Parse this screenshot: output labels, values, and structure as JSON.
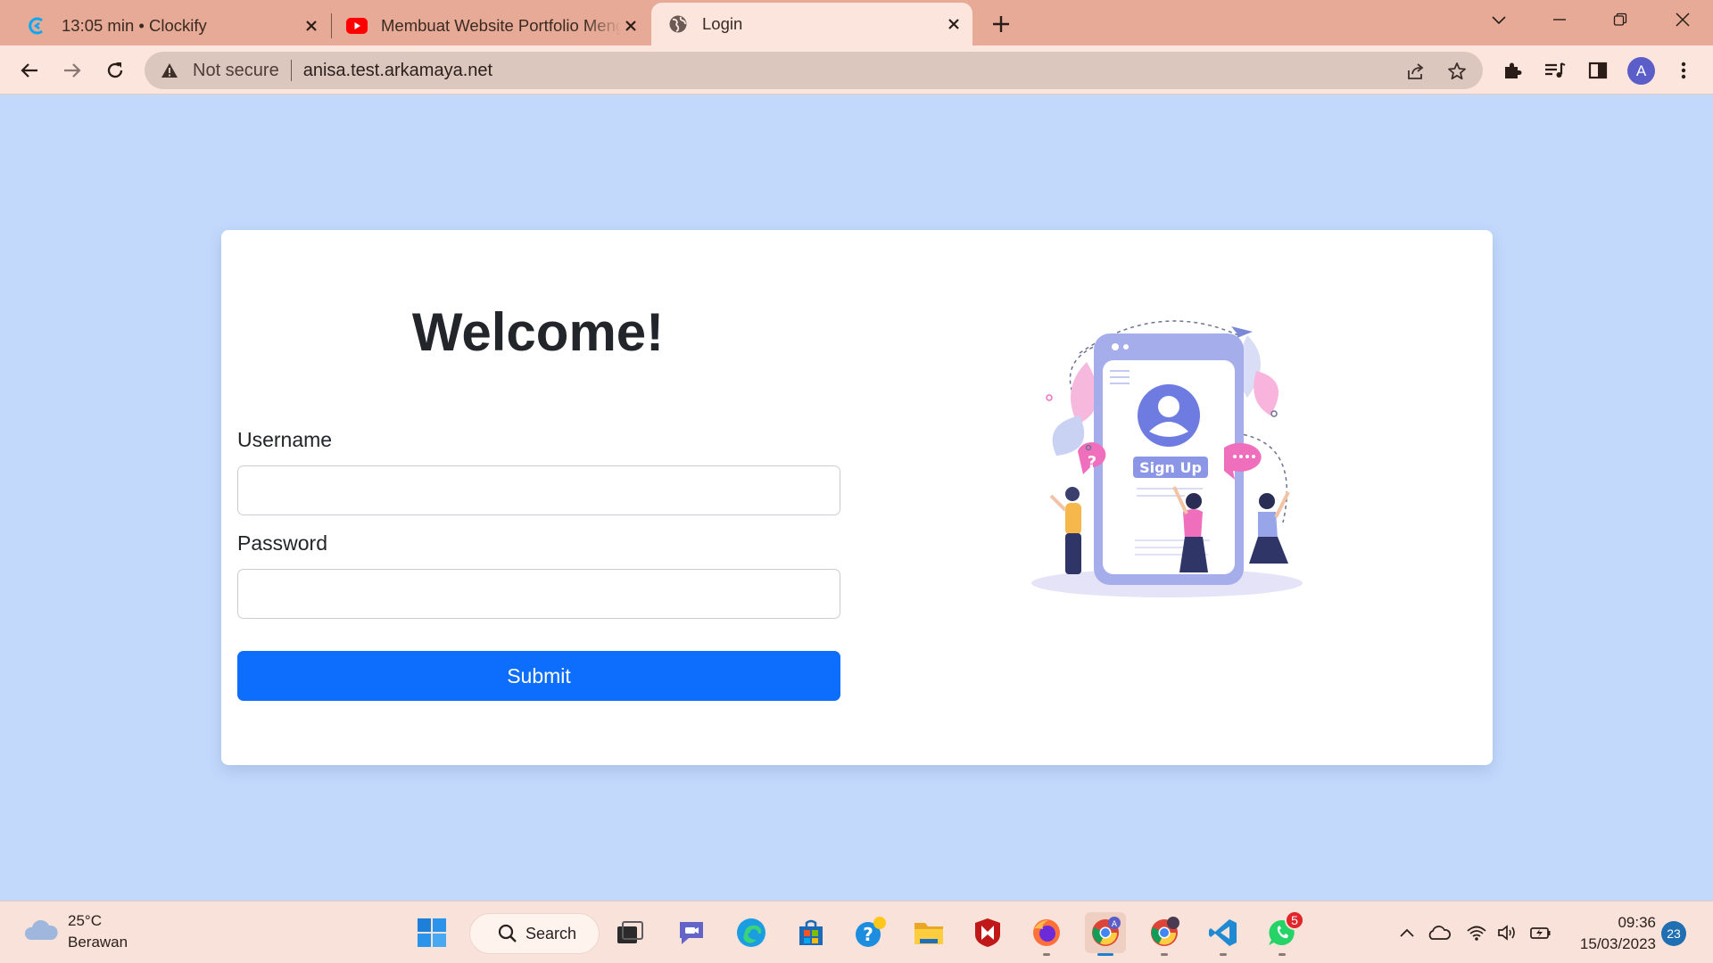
{
  "browser": {
    "tabs": [
      {
        "title": "13:05 min • Clockify",
        "icon": "clockify-icon",
        "active": false
      },
      {
        "title": "Membuat Website Portfolio Menggunakan",
        "icon": "youtube-icon",
        "active": false
      },
      {
        "title": "Login",
        "icon": "globe-icon",
        "active": true
      }
    ],
    "address": {
      "security_label": "Not secure",
      "url": "anisa.test.arkamaya.net"
    },
    "profile_initial": "A"
  },
  "page": {
    "heading": "Welcome!",
    "form": {
      "username_label": "Username",
      "username_value": "",
      "password_label": "Password",
      "password_value": "",
      "submit_label": "Submit"
    },
    "illustration": {
      "badge_text": "Sign Up"
    },
    "colors": {
      "background": "#c2d9fc",
      "primary": "#0d6efd"
    }
  },
  "taskbar": {
    "weather": {
      "temp": "25°C",
      "condition": "Berawan"
    },
    "search_label": "Search",
    "whatsapp_badge": "5",
    "clock": {
      "time": "09:36",
      "date": "15/03/2023"
    },
    "notification_count": "23"
  }
}
